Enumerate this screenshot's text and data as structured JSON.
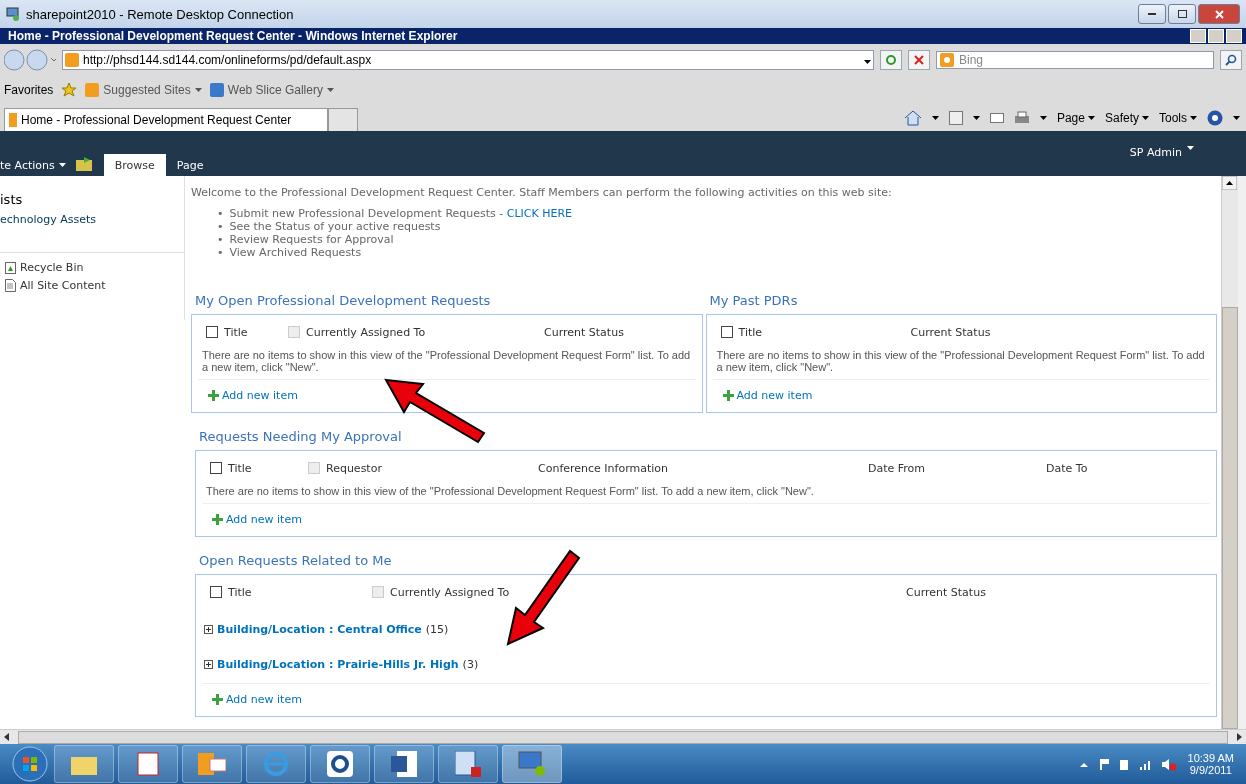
{
  "rdp_window": {
    "title": "sharepoint2010 - Remote Desktop Connection"
  },
  "ie_window": {
    "title": "Home - Professional Development Request Center - Windows Internet Explorer"
  },
  "address_bar": {
    "url": "http://phsd144.sd144.com/onlineforms/pd/default.aspx"
  },
  "search": {
    "placeholder": "Bing"
  },
  "favorites_bar": {
    "label": "Favorites",
    "items": [
      "Suggested Sites",
      "Web Slice Gallery"
    ]
  },
  "browser_tabs": [
    {
      "label": "Home - Professional Development Request Center",
      "selected": true
    }
  ],
  "command_bar": [
    "Page",
    "Safety",
    "Tools"
  ],
  "ribbon": {
    "site_actions": "te Actions",
    "tabs": [
      {
        "label": "Browse",
        "selected": true
      },
      {
        "label": "Page",
        "selected": false
      }
    ],
    "user": "SP Admin"
  },
  "sidebar": {
    "heading": "ists",
    "items": [
      "echnology Assets"
    ],
    "footer": [
      {
        "kind": "recycle",
        "label": "Recycle Bin"
      },
      {
        "kind": "content",
        "label": "All Site Content"
      }
    ]
  },
  "welcome": {
    "intro": "Welcome to the Professional Development Request Center.  Staff Members can perform the following activities on this web site:",
    "bullets": [
      {
        "marker": "•",
        "text": "Submit new Professional Development Requests - ",
        "link": "CLICK HERE"
      },
      {
        "marker": "•",
        "text": "See the Status of your active requests"
      },
      {
        "marker": "•",
        "text": "Review Requests for Approval"
      },
      {
        "marker": "•",
        "text": "View Archived Requests"
      }
    ]
  },
  "zones": [
    {
      "web_parts": [
        {
          "title": "My Open Professional Development Requests",
          "columns": [
            {
              "label": "Title",
              "kind": "select",
              "checked": false
            },
            {
              "label": "Currently Assigned To",
              "kind": "filter",
              "checked": false
            },
            {
              "label": "Current Status",
              "kind": "plain"
            }
          ],
          "empty_message": "There are no items to show in this view of the \"Professional Development Request Form\" list. To add a new item, click \"New\".",
          "add_label": "Add new item"
        },
        {
          "title": "My Past PDRs",
          "columns": [
            {
              "label": "Title",
              "kind": "select",
              "checked": false
            },
            {
              "label": "Current Status",
              "kind": "plain"
            }
          ],
          "empty_message": "There are no items to show in this view of the \"Professional Development Request Form\" list. To add a new item, click \"New\".",
          "add_label": "Add new item"
        }
      ]
    },
    {
      "web_parts": [
        {
          "title": "Requests Needing My Approval",
          "columns": [
            {
              "label": "Title",
              "kind": "select",
              "checked": false
            },
            {
              "label": "Requestor",
              "kind": "filter",
              "checked": false
            },
            {
              "label": "Conference Information",
              "kind": "plain"
            },
            {
              "label": "Date From",
              "kind": "plain"
            },
            {
              "label": "Date To",
              "kind": "plain"
            }
          ],
          "empty_message": "There are no items to show in this view of the \"Professional Development Request Form\" list. To add a new item, click \"New\".",
          "add_label": "Add new item"
        }
      ]
    },
    {
      "web_parts": [
        {
          "title": "Open Requests Related to Me",
          "columns": [
            {
              "label": "Title",
              "kind": "select",
              "checked": false
            },
            {
              "label": "Currently Assigned To",
              "kind": "filter",
              "checked": false
            },
            {
              "label": "Current Status",
              "kind": "plain"
            }
          ],
          "groups": [
            {
              "field": "Building/Location",
              "separator": ":",
              "value": "Central Office",
              "count": "(15)",
              "expanded": false
            },
            {
              "field": "Building/Location",
              "separator": ":",
              "value": "Prairie-Hills Jr. High",
              "count": "(3)",
              "expanded": false
            }
          ],
          "add_label": "Add new item"
        }
      ]
    }
  ],
  "taskbar": {
    "time": "10:39 AM",
    "date": "9/9/2011"
  }
}
